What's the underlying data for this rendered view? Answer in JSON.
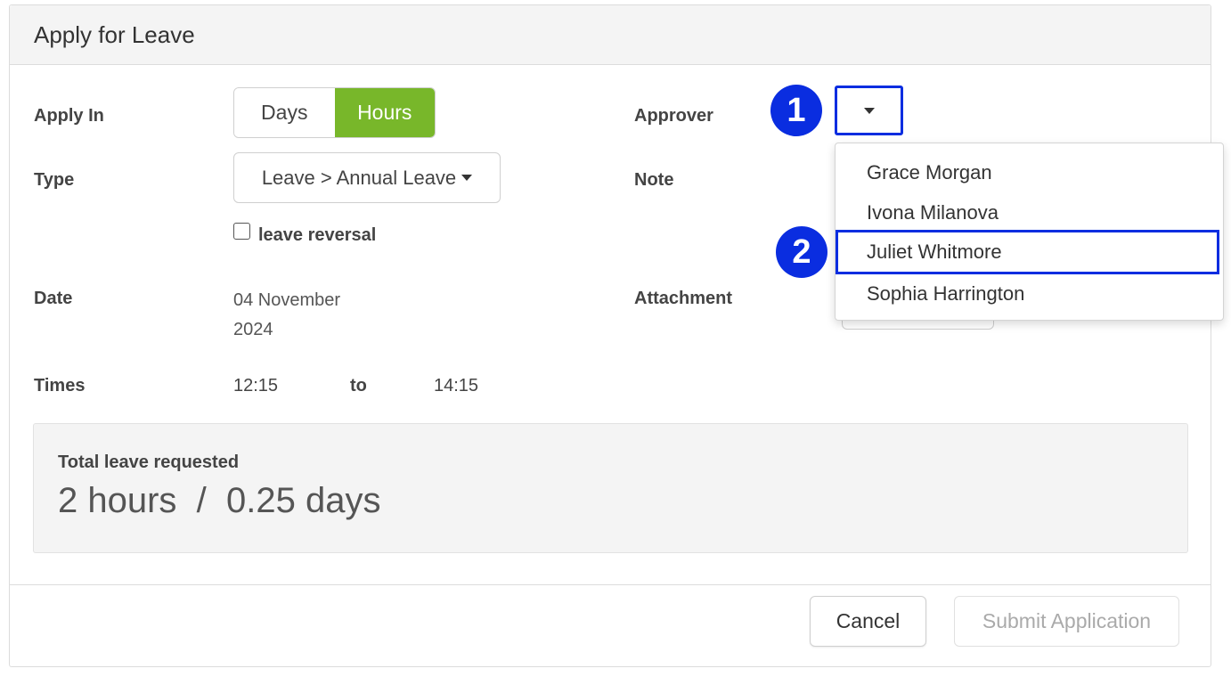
{
  "header": {
    "title": "Apply for Leave"
  },
  "form": {
    "apply_in_label": "Apply In",
    "apply_in_options": [
      "Days",
      "Hours"
    ],
    "apply_in_selected": "Hours",
    "type_label": "Type",
    "type_value": "Leave > Annual Leave",
    "leave_reversal_label": "leave reversal",
    "leave_reversal_checked": false,
    "date_label": "Date",
    "date_value": "04 November 2024",
    "times_label": "Times",
    "time_from": "12:15",
    "time_to_label": "to",
    "time_to": "14:15",
    "approver_label": "Approver",
    "note_label": "Note",
    "attachment_label": "Attachment"
  },
  "summary": {
    "label": "Total leave requested",
    "value": "2 hours  /  0.25 days"
  },
  "approver_dropdown": {
    "options": [
      "Grace Morgan",
      "Ivona Milanova",
      "Juliet Whitmore",
      "Sophia Harrington"
    ],
    "highlighted": "Juliet Whitmore"
  },
  "footer": {
    "cancel_label": "Cancel",
    "submit_label": "Submit Application"
  },
  "markers": [
    "1",
    "2"
  ],
  "colors": {
    "accent_green": "#78b72a",
    "highlight_blue": "#0a2de0",
    "header_bg": "#f4f4f4"
  }
}
